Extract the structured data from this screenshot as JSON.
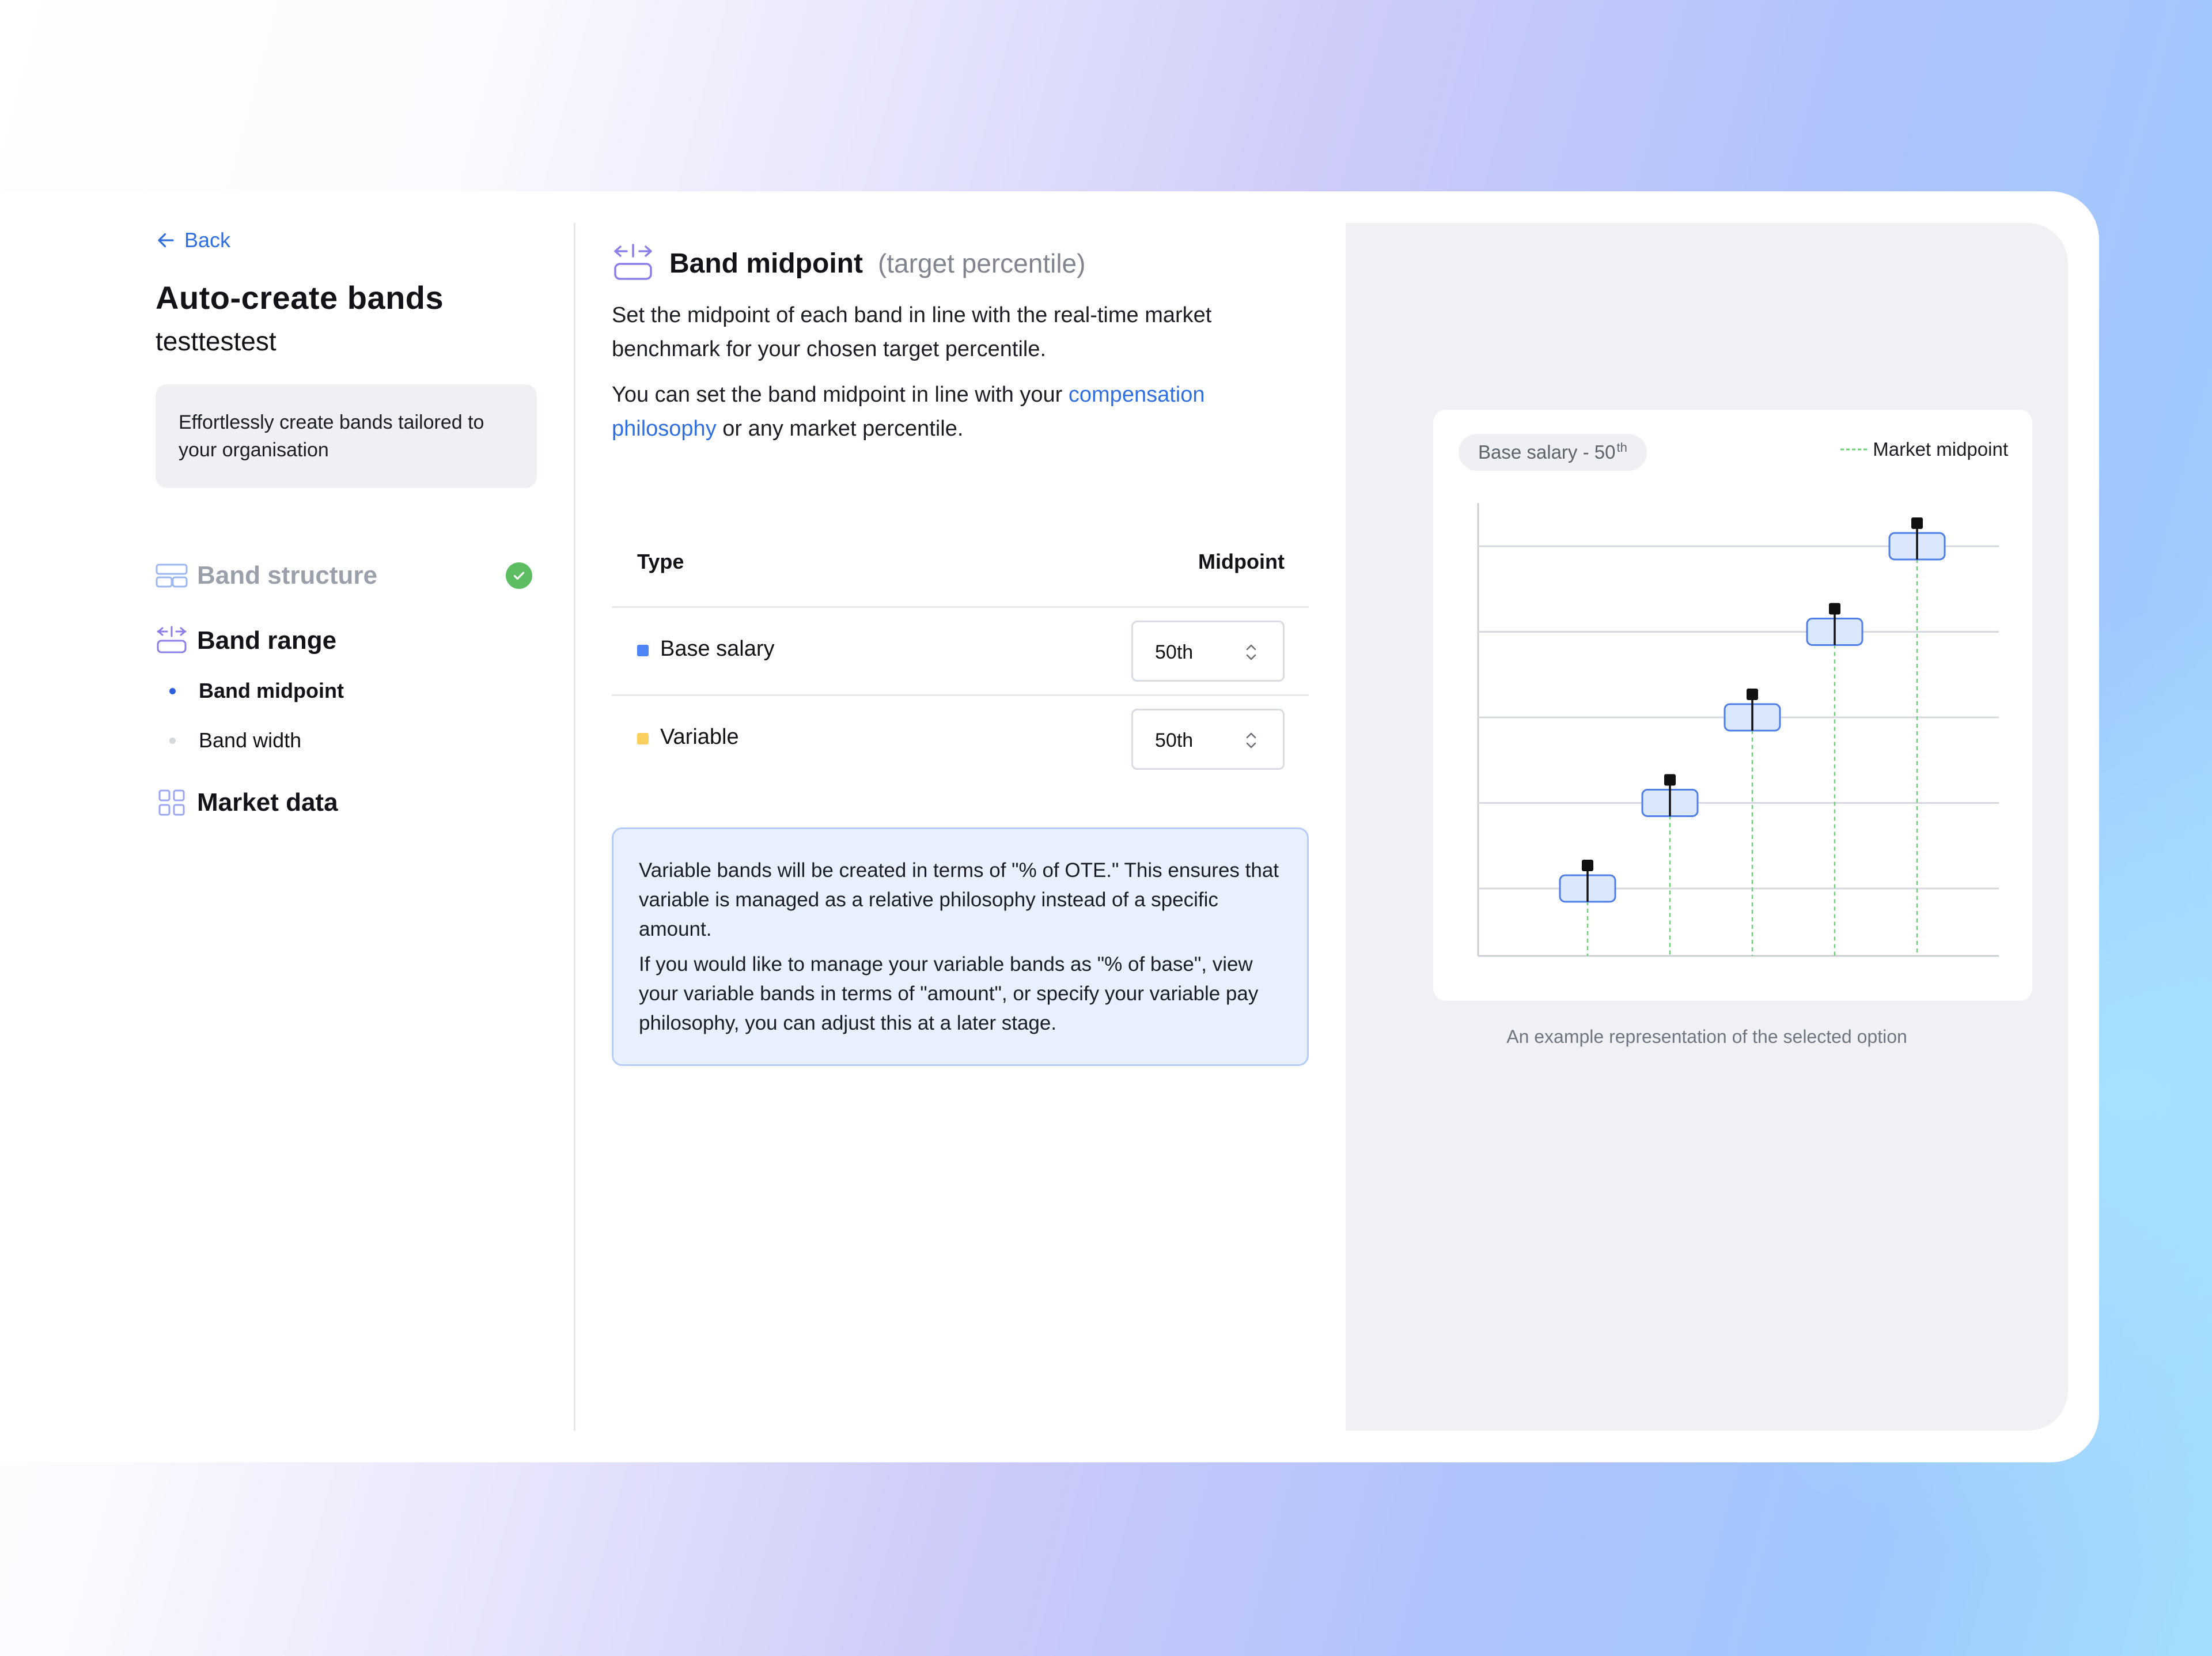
{
  "nav": {
    "back_label": "Back"
  },
  "page": {
    "title": "Auto-create bands",
    "subtitle": "testtestest"
  },
  "intro": {
    "text": "Effortlessly create bands tailored to your organisation"
  },
  "steps": [
    {
      "label": "Band structure",
      "state": "completed",
      "icon": "band-structure-icon"
    },
    {
      "label": "Band range",
      "state": "active",
      "icon": "band-range-icon",
      "substeps": [
        {
          "label": "Band midpoint",
          "state": "active"
        },
        {
          "label": "Band width",
          "state": "upcoming"
        }
      ]
    },
    {
      "label": "Market data",
      "state": "upcoming",
      "icon": "grid-icon"
    }
  ],
  "section": {
    "title": "Band midpoint",
    "title_paren": "(target percentile)",
    "icon": "band-midpoint-icon",
    "para1": "Set the midpoint of each band in line with the real-time market benchmark for your chosen target percentile.",
    "para2_prefix": "You can set the band midpoint in line with your",
    "para2_link": "compensation philosophy",
    "para2_suffix": "or any market percentile."
  },
  "table": {
    "col_type": "Type",
    "col_midpoint": "Midpoint",
    "rows": [
      {
        "type": "Base salary",
        "midpoint": "50th",
        "color": "#4f86f7"
      },
      {
        "type": "Variable",
        "midpoint": "50th",
        "color": "#f9cf5d"
      }
    ]
  },
  "note": {
    "p1": "Variable bands will be created in terms of \"% of OTE.\" This ensures that variable is managed as a relative philosophy instead of a specific amount.",
    "p2": "If you would like to manage your variable bands as \"% of base\", view your variable bands in terms of \"amount\", or specify your variable pay philosophy, you can adjust this at a later stage."
  },
  "preview": {
    "chip_label": "Base salary - 50",
    "chip_sup": "th",
    "legend_label": "Market midpoint",
    "caption": "An example representation of the selected option",
    "band_count": 5
  },
  "colors": {
    "accent": "#2f6fe0",
    "success": "#5cbd62",
    "market_line": "#6fcf75",
    "band_fill": "#dbe7fb",
    "band_stroke": "#4f7fe6"
  }
}
